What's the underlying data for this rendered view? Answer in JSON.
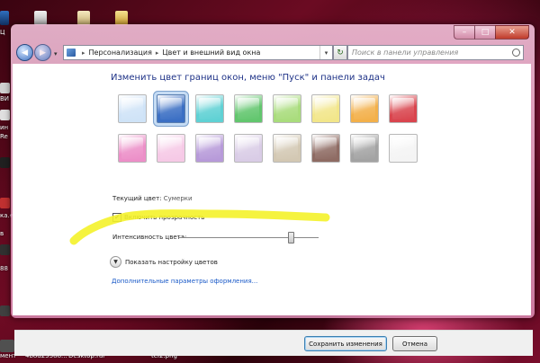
{
  "desktop": {
    "left_labels": [
      "Ц",
      "ВИ",
      "ин",
      "Re",
      "ка.ғ",
      "в",
      "88"
    ],
    "taskbar_items": [
      {
        "label": "мент"
      },
      {
        "label": "4b8d25588..."
      },
      {
        "label": "Desktop.rar"
      },
      {
        "label": "tel2.png"
      }
    ]
  },
  "window": {
    "controls": {
      "minimize": "–",
      "maximize": "□",
      "close": "✕"
    },
    "nav": {
      "back": "◀",
      "forward": "▶",
      "dropdown": "▾"
    },
    "breadcrumb": [
      "Персонализация",
      "Цвет и внешний вид окна"
    ],
    "breadcrumb_sep": "▸",
    "address_dropdown": "▾",
    "refresh": "↻",
    "search_placeholder": "Поиск в панели управления"
  },
  "page": {
    "heading": "Изменить цвет границ окон, меню \"Пуск\" и панели задач",
    "swatches": [
      {
        "name": "sky",
        "color": "#cfe3f7"
      },
      {
        "name": "twilight",
        "color": "#3b6fc4",
        "selected": true
      },
      {
        "name": "sea",
        "color": "#5fd1d4"
      },
      {
        "name": "leaf",
        "color": "#62c66e"
      },
      {
        "name": "lime",
        "color": "#a9dc7c"
      },
      {
        "name": "lemon",
        "color": "#f2e68a"
      },
      {
        "name": "pumpkin",
        "color": "#f3b04a"
      },
      {
        "name": "ruby",
        "color": "#d9454e"
      },
      {
        "name": "fuchsia",
        "color": "#ec8fc8"
      },
      {
        "name": "blush",
        "color": "#f6c9e6"
      },
      {
        "name": "violet",
        "color": "#b79ad9"
      },
      {
        "name": "lavender",
        "color": "#d9cce6"
      },
      {
        "name": "taupe",
        "color": "#d3c8b3"
      },
      {
        "name": "chocolate",
        "color": "#8e6b63"
      },
      {
        "name": "slate",
        "color": "#a3a3a3"
      },
      {
        "name": "frost",
        "color": "#f4f4f4"
      }
    ],
    "current_color_label": "Текущий цвет:",
    "current_color_value": "Сумерки",
    "transparency_label": "Включить прозрачность",
    "transparency_checked": "✔",
    "intensity_label": "Интенсивность цвета:",
    "intensity_fraction": 0.8,
    "expander_icon": "▼",
    "expander_label": "Показать настройку цветов",
    "advanced_link": "Дополнительные параметры оформления..."
  },
  "buttons": {
    "save": "Сохранить изменения",
    "cancel": "Отмена"
  },
  "annotation": {
    "color": "#f4f22a"
  }
}
